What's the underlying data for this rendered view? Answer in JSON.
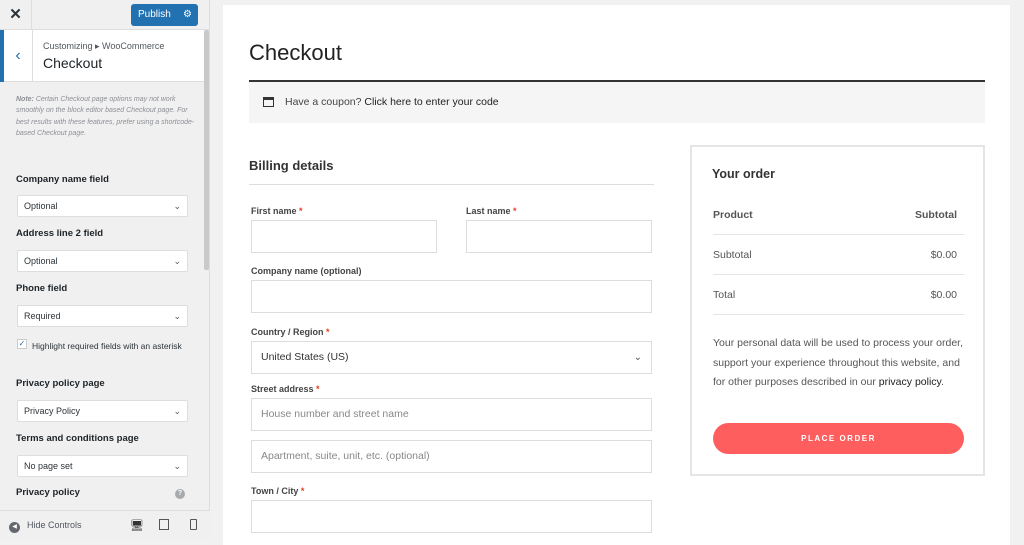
{
  "sidebar": {
    "close_label": "✕",
    "publish_label": "Publish",
    "breadcrumb": "Customizing ▸ WooCommerce",
    "section_title": "Checkout",
    "note_label": "Note:",
    "note_text": " Certain Checkout page options may not work smoothly on the block editor based Checkout page. For best results with these features, prefer using a shortcode-based Checkout page.",
    "fields": [
      {
        "label": "Company name field",
        "value": "Optional"
      },
      {
        "label": "Address line 2 field",
        "value": "Optional"
      },
      {
        "label": "Phone field",
        "value": "Required"
      }
    ],
    "highlight_checkbox": {
      "label": "Highlight required fields with an asterisk",
      "checked": true
    },
    "privacy_page": {
      "label": "Privacy policy page",
      "value": "Privacy Policy"
    },
    "terms_page": {
      "label": "Terms and conditions page",
      "value": "No page set"
    },
    "privacy_policy_label": "Privacy policy",
    "hide_controls": "Hide Controls"
  },
  "main": {
    "title": "Checkout",
    "coupon_text": "Have a coupon? ",
    "coupon_link": "Click here to enter your code",
    "billing_title": "Billing details",
    "first_name": "First name",
    "last_name": "Last name",
    "company": "Company name (optional)",
    "country": "Country / Region",
    "country_value": "United States (US)",
    "street": "Street address",
    "street_ph": "House number and street name",
    "apt_ph": "Apartment, suite, unit, etc. (optional)",
    "town": "Town / City",
    "required_mark": "*"
  },
  "order": {
    "title": "Your order",
    "product_header": "Product",
    "subtotal_header": "Subtotal",
    "subtotal_label": "Subtotal",
    "subtotal_value": "$0.00",
    "total_label": "Total",
    "total_value": "$0.00",
    "privacy_text": "Your personal data will be used to process your order, support your experience throughout this website, and for other purposes described in our ",
    "privacy_link": "privacy policy",
    "privacy_end": ".",
    "place_order": "PLACE ORDER"
  },
  "colors": {
    "accent": "#2271b1",
    "button": "#ff5e5e"
  }
}
